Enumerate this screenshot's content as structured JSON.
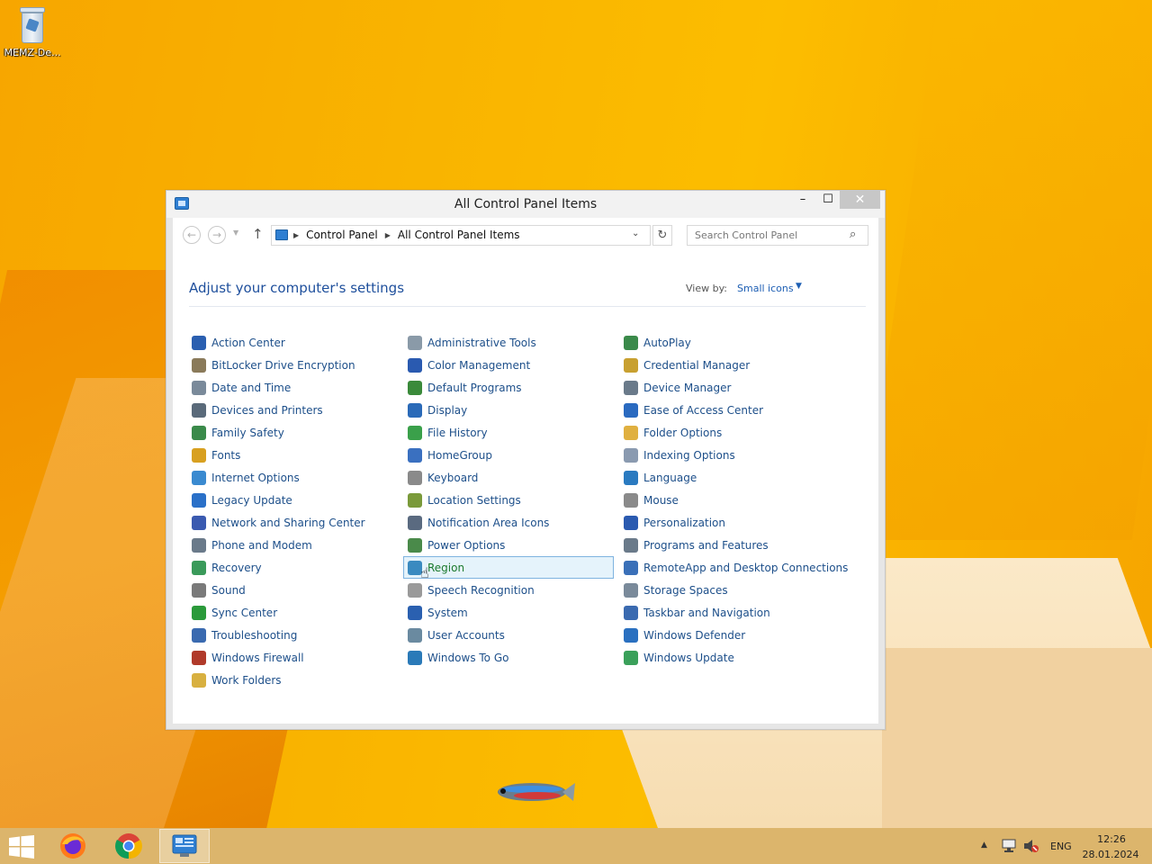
{
  "desktop": {
    "icons": [
      {
        "label": "MEMZ-De...",
        "icon": "recycle-bin-icon"
      }
    ]
  },
  "window": {
    "title": "All Control Panel Items",
    "controls": {
      "minimize": "–",
      "maximize": "☐",
      "close": "✕"
    }
  },
  "navigation": {
    "breadcrumb": [
      "Control Panel",
      "All Control Panel Items"
    ],
    "search_placeholder": "Search Control Panel"
  },
  "main": {
    "heading": "Adjust your computer's settings",
    "view_by_label": "View by:",
    "view_by_value": "Small icons",
    "columns": [
      [
        {
          "label": "Action Center",
          "icon": "flag-icon",
          "color": "#2a5fb0"
        },
        {
          "label": "BitLocker Drive Encryption",
          "icon": "bitlocker-icon",
          "color": "#8a7a5a"
        },
        {
          "label": "Date and Time",
          "icon": "clock-icon",
          "color": "#7a8a9a"
        },
        {
          "label": "Devices and Printers",
          "icon": "printer-icon",
          "color": "#5a6a7a"
        },
        {
          "label": "Family Safety",
          "icon": "family-icon",
          "color": "#3a8a4a"
        },
        {
          "label": "Fonts",
          "icon": "fonts-icon",
          "color": "#d8a020"
        },
        {
          "label": "Internet Options",
          "icon": "globe-icon",
          "color": "#3a8ad0"
        },
        {
          "label": "Legacy Update",
          "icon": "update-globe-icon",
          "color": "#2a70c8"
        },
        {
          "label": "Network and Sharing Center",
          "icon": "network-icon",
          "color": "#3a5ab0"
        },
        {
          "label": "Phone and Modem",
          "icon": "phone-icon",
          "color": "#6a7a8a"
        },
        {
          "label": "Recovery",
          "icon": "recovery-icon",
          "color": "#3a9a5a"
        },
        {
          "label": "Sound",
          "icon": "speaker-icon",
          "color": "#7a7a7a"
        },
        {
          "label": "Sync Center",
          "icon": "sync-icon",
          "color": "#2a9a3a"
        },
        {
          "label": "Troubleshooting",
          "icon": "troubleshoot-icon",
          "color": "#3a6ab0"
        },
        {
          "label": "Windows Firewall",
          "icon": "firewall-icon",
          "color": "#b03a2a"
        },
        {
          "label": "Work Folders",
          "icon": "work-folders-icon",
          "color": "#d8b040"
        }
      ],
      [
        {
          "label": "Administrative Tools",
          "icon": "admin-tools-icon",
          "color": "#8a9aa8"
        },
        {
          "label": "Color Management",
          "icon": "color-monitor-icon",
          "color": "#2a5ab0"
        },
        {
          "label": "Default Programs",
          "icon": "default-programs-icon",
          "color": "#3a8a3a"
        },
        {
          "label": "Display",
          "icon": "display-icon",
          "color": "#2a6ab8"
        },
        {
          "label": "File History",
          "icon": "file-history-icon",
          "color": "#3aa04a"
        },
        {
          "label": "HomeGroup",
          "icon": "homegroup-icon",
          "color": "#3a70c0"
        },
        {
          "label": "Keyboard",
          "icon": "keyboard-icon",
          "color": "#8a8a8a"
        },
        {
          "label": "Location Settings",
          "icon": "location-icon",
          "color": "#7a9a3a"
        },
        {
          "label": "Notification Area Icons",
          "icon": "notification-icon",
          "color": "#5a6a80"
        },
        {
          "label": "Power Options",
          "icon": "power-icon",
          "color": "#4a8a4a"
        },
        {
          "label": "Region",
          "icon": "region-globe-icon",
          "color": "#3a8ac0",
          "selected": true
        },
        {
          "label": "Speech Recognition",
          "icon": "microphone-icon",
          "color": "#9a9a9a"
        },
        {
          "label": "System",
          "icon": "system-icon",
          "color": "#2a60b0"
        },
        {
          "label": "User Accounts",
          "icon": "users-icon",
          "color": "#6a8aa0"
        },
        {
          "label": "Windows To Go",
          "icon": "windows-to-go-icon",
          "color": "#2a7ab8"
        }
      ],
      [
        {
          "label": "AutoPlay",
          "icon": "autoplay-icon",
          "color": "#3a8a4a"
        },
        {
          "label": "Credential Manager",
          "icon": "credential-icon",
          "color": "#c8a030"
        },
        {
          "label": "Device Manager",
          "icon": "device-manager-icon",
          "color": "#6a7a8a"
        },
        {
          "label": "Ease of Access Center",
          "icon": "ease-of-access-icon",
          "color": "#2a6ac0"
        },
        {
          "label": "Folder Options",
          "icon": "folder-options-icon",
          "color": "#e0b040"
        },
        {
          "label": "Indexing Options",
          "icon": "indexing-icon",
          "color": "#8a9ab0"
        },
        {
          "label": "Language",
          "icon": "language-icon",
          "color": "#2a7ac0"
        },
        {
          "label": "Mouse",
          "icon": "mouse-icon",
          "color": "#8a8a8a"
        },
        {
          "label": "Personalization",
          "icon": "personalization-icon",
          "color": "#2a5ab0"
        },
        {
          "label": "Programs and Features",
          "icon": "programs-icon",
          "color": "#6a7a8a"
        },
        {
          "label": "RemoteApp and Desktop Connections",
          "icon": "remoteapp-icon",
          "color": "#3a70b8"
        },
        {
          "label": "Storage Spaces",
          "icon": "storage-icon",
          "color": "#7a8a9a"
        },
        {
          "label": "Taskbar and Navigation",
          "icon": "taskbar-icon",
          "color": "#3a6ab0"
        },
        {
          "label": "Windows Defender",
          "icon": "defender-icon",
          "color": "#2a70c0"
        },
        {
          "label": "Windows Update",
          "icon": "windows-update-icon",
          "color": "#3aa05a"
        }
      ]
    ]
  },
  "taskbar": {
    "apps": [
      {
        "name": "Firefox",
        "icon": "firefox-icon"
      },
      {
        "name": "Chrome",
        "icon": "chrome-icon"
      },
      {
        "name": "Control Panel",
        "icon": "control-panel-icon",
        "active": true
      }
    ],
    "tray": {
      "language": "ENG",
      "time": "12:26",
      "date": "28.01.2024"
    }
  }
}
